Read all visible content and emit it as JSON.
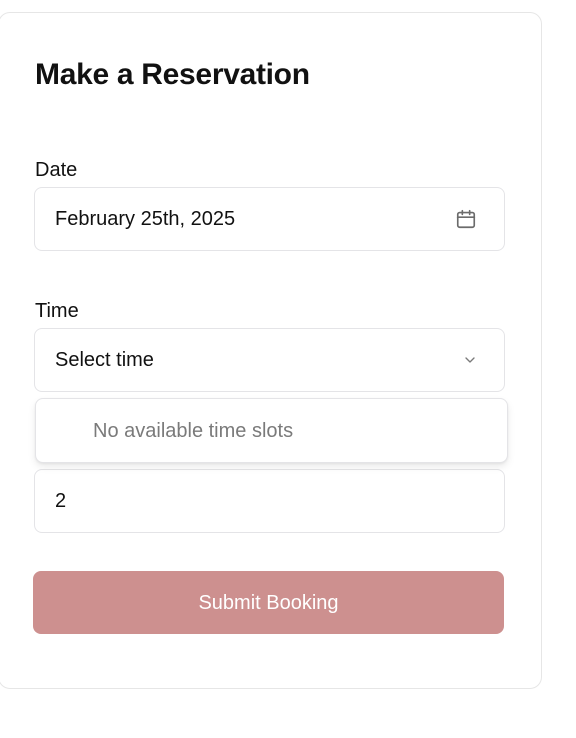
{
  "form": {
    "title": "Make a Reservation",
    "date": {
      "label": "Date",
      "value": "February 25th, 2025",
      "icon": "calendar-icon"
    },
    "time": {
      "label": "Time",
      "placeholder": "Select time",
      "icon": "chevron-down-icon",
      "dropdown_empty_text": "No available time slots"
    },
    "guests": {
      "value": "2"
    },
    "submit_label": "Submit Booking",
    "colors": {
      "submit_background": "#cd908f",
      "border": "#e4e4e7",
      "muted_text": "#7a7a7a"
    }
  }
}
